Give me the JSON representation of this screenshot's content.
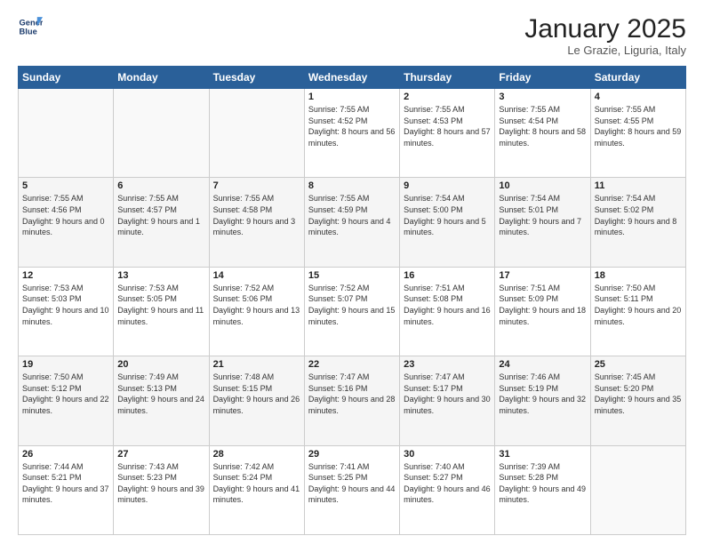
{
  "header": {
    "logo_line1": "General",
    "logo_line2": "Blue",
    "month": "January 2025",
    "location": "Le Grazie, Liguria, Italy"
  },
  "weekdays": [
    "Sunday",
    "Monday",
    "Tuesday",
    "Wednesday",
    "Thursday",
    "Friday",
    "Saturday"
  ],
  "weeks": [
    [
      {
        "day": "",
        "sunrise": "",
        "sunset": "",
        "daylight": ""
      },
      {
        "day": "",
        "sunrise": "",
        "sunset": "",
        "daylight": ""
      },
      {
        "day": "",
        "sunrise": "",
        "sunset": "",
        "daylight": ""
      },
      {
        "day": "1",
        "sunrise": "Sunrise: 7:55 AM",
        "sunset": "Sunset: 4:52 PM",
        "daylight": "Daylight: 8 hours and 56 minutes."
      },
      {
        "day": "2",
        "sunrise": "Sunrise: 7:55 AM",
        "sunset": "Sunset: 4:53 PM",
        "daylight": "Daylight: 8 hours and 57 minutes."
      },
      {
        "day": "3",
        "sunrise": "Sunrise: 7:55 AM",
        "sunset": "Sunset: 4:54 PM",
        "daylight": "Daylight: 8 hours and 58 minutes."
      },
      {
        "day": "4",
        "sunrise": "Sunrise: 7:55 AM",
        "sunset": "Sunset: 4:55 PM",
        "daylight": "Daylight: 8 hours and 59 minutes."
      }
    ],
    [
      {
        "day": "5",
        "sunrise": "Sunrise: 7:55 AM",
        "sunset": "Sunset: 4:56 PM",
        "daylight": "Daylight: 9 hours and 0 minutes."
      },
      {
        "day": "6",
        "sunrise": "Sunrise: 7:55 AM",
        "sunset": "Sunset: 4:57 PM",
        "daylight": "Daylight: 9 hours and 1 minute."
      },
      {
        "day": "7",
        "sunrise": "Sunrise: 7:55 AM",
        "sunset": "Sunset: 4:58 PM",
        "daylight": "Daylight: 9 hours and 3 minutes."
      },
      {
        "day": "8",
        "sunrise": "Sunrise: 7:55 AM",
        "sunset": "Sunset: 4:59 PM",
        "daylight": "Daylight: 9 hours and 4 minutes."
      },
      {
        "day": "9",
        "sunrise": "Sunrise: 7:54 AM",
        "sunset": "Sunset: 5:00 PM",
        "daylight": "Daylight: 9 hours and 5 minutes."
      },
      {
        "day": "10",
        "sunrise": "Sunrise: 7:54 AM",
        "sunset": "Sunset: 5:01 PM",
        "daylight": "Daylight: 9 hours and 7 minutes."
      },
      {
        "day": "11",
        "sunrise": "Sunrise: 7:54 AM",
        "sunset": "Sunset: 5:02 PM",
        "daylight": "Daylight: 9 hours and 8 minutes."
      }
    ],
    [
      {
        "day": "12",
        "sunrise": "Sunrise: 7:53 AM",
        "sunset": "Sunset: 5:03 PM",
        "daylight": "Daylight: 9 hours and 10 minutes."
      },
      {
        "day": "13",
        "sunrise": "Sunrise: 7:53 AM",
        "sunset": "Sunset: 5:05 PM",
        "daylight": "Daylight: 9 hours and 11 minutes."
      },
      {
        "day": "14",
        "sunrise": "Sunrise: 7:52 AM",
        "sunset": "Sunset: 5:06 PM",
        "daylight": "Daylight: 9 hours and 13 minutes."
      },
      {
        "day": "15",
        "sunrise": "Sunrise: 7:52 AM",
        "sunset": "Sunset: 5:07 PM",
        "daylight": "Daylight: 9 hours and 15 minutes."
      },
      {
        "day": "16",
        "sunrise": "Sunrise: 7:51 AM",
        "sunset": "Sunset: 5:08 PM",
        "daylight": "Daylight: 9 hours and 16 minutes."
      },
      {
        "day": "17",
        "sunrise": "Sunrise: 7:51 AM",
        "sunset": "Sunset: 5:09 PM",
        "daylight": "Daylight: 9 hours and 18 minutes."
      },
      {
        "day": "18",
        "sunrise": "Sunrise: 7:50 AM",
        "sunset": "Sunset: 5:11 PM",
        "daylight": "Daylight: 9 hours and 20 minutes."
      }
    ],
    [
      {
        "day": "19",
        "sunrise": "Sunrise: 7:50 AM",
        "sunset": "Sunset: 5:12 PM",
        "daylight": "Daylight: 9 hours and 22 minutes."
      },
      {
        "day": "20",
        "sunrise": "Sunrise: 7:49 AM",
        "sunset": "Sunset: 5:13 PM",
        "daylight": "Daylight: 9 hours and 24 minutes."
      },
      {
        "day": "21",
        "sunrise": "Sunrise: 7:48 AM",
        "sunset": "Sunset: 5:15 PM",
        "daylight": "Daylight: 9 hours and 26 minutes."
      },
      {
        "day": "22",
        "sunrise": "Sunrise: 7:47 AM",
        "sunset": "Sunset: 5:16 PM",
        "daylight": "Daylight: 9 hours and 28 minutes."
      },
      {
        "day": "23",
        "sunrise": "Sunrise: 7:47 AM",
        "sunset": "Sunset: 5:17 PM",
        "daylight": "Daylight: 9 hours and 30 minutes."
      },
      {
        "day": "24",
        "sunrise": "Sunrise: 7:46 AM",
        "sunset": "Sunset: 5:19 PM",
        "daylight": "Daylight: 9 hours and 32 minutes."
      },
      {
        "day": "25",
        "sunrise": "Sunrise: 7:45 AM",
        "sunset": "Sunset: 5:20 PM",
        "daylight": "Daylight: 9 hours and 35 minutes."
      }
    ],
    [
      {
        "day": "26",
        "sunrise": "Sunrise: 7:44 AM",
        "sunset": "Sunset: 5:21 PM",
        "daylight": "Daylight: 9 hours and 37 minutes."
      },
      {
        "day": "27",
        "sunrise": "Sunrise: 7:43 AM",
        "sunset": "Sunset: 5:23 PM",
        "daylight": "Daylight: 9 hours and 39 minutes."
      },
      {
        "day": "28",
        "sunrise": "Sunrise: 7:42 AM",
        "sunset": "Sunset: 5:24 PM",
        "daylight": "Daylight: 9 hours and 41 minutes."
      },
      {
        "day": "29",
        "sunrise": "Sunrise: 7:41 AM",
        "sunset": "Sunset: 5:25 PM",
        "daylight": "Daylight: 9 hours and 44 minutes."
      },
      {
        "day": "30",
        "sunrise": "Sunrise: 7:40 AM",
        "sunset": "Sunset: 5:27 PM",
        "daylight": "Daylight: 9 hours and 46 minutes."
      },
      {
        "day": "31",
        "sunrise": "Sunrise: 7:39 AM",
        "sunset": "Sunset: 5:28 PM",
        "daylight": "Daylight: 9 hours and 49 minutes."
      },
      {
        "day": "",
        "sunrise": "",
        "sunset": "",
        "daylight": ""
      }
    ]
  ]
}
